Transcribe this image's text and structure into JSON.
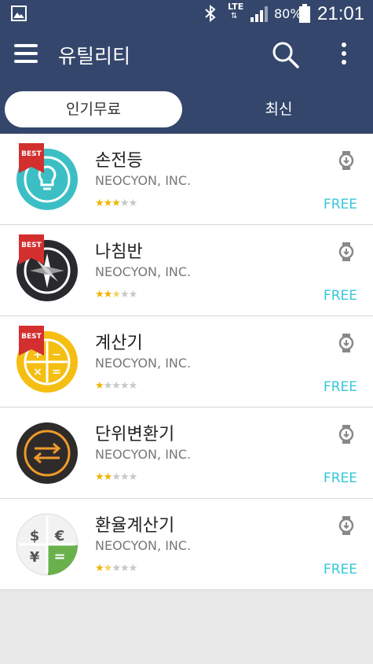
{
  "status_bar": {
    "network": "LTE",
    "network_arrows": "⇅",
    "battery": "80%",
    "time": "21:01"
  },
  "app_bar": {
    "title": "유틸리티"
  },
  "tabs": [
    {
      "label": "인기무료",
      "active": true
    },
    {
      "label": "최신",
      "active": false
    }
  ],
  "apps": [
    {
      "name": "손전등",
      "developer": "NEOCYON, INC.",
      "rating": 3,
      "price": "FREE",
      "badge": "BEST",
      "icon": "flashlight-icon"
    },
    {
      "name": "나침반",
      "developer": "NEOCYON, INC.",
      "rating": 2.5,
      "price": "FREE",
      "badge": "BEST",
      "icon": "compass-icon"
    },
    {
      "name": "계산기",
      "developer": "NEOCYON, INC.",
      "rating": 1,
      "price": "FREE",
      "badge": "BEST",
      "icon": "calculator-icon"
    },
    {
      "name": "단위변환기",
      "developer": "NEOCYON, INC.",
      "rating": 2,
      "price": "FREE",
      "badge": "",
      "icon": "unit-converter-icon"
    },
    {
      "name": "환율계산기",
      "developer": "NEOCYON, INC.",
      "rating": 1.5,
      "price": "FREE",
      "badge": "",
      "icon": "currency-calculator-icon"
    }
  ],
  "colors": {
    "header": "#34466b",
    "price": "#35c8d8",
    "star": "#f0b400",
    "best_badge": "#d32f2f"
  }
}
